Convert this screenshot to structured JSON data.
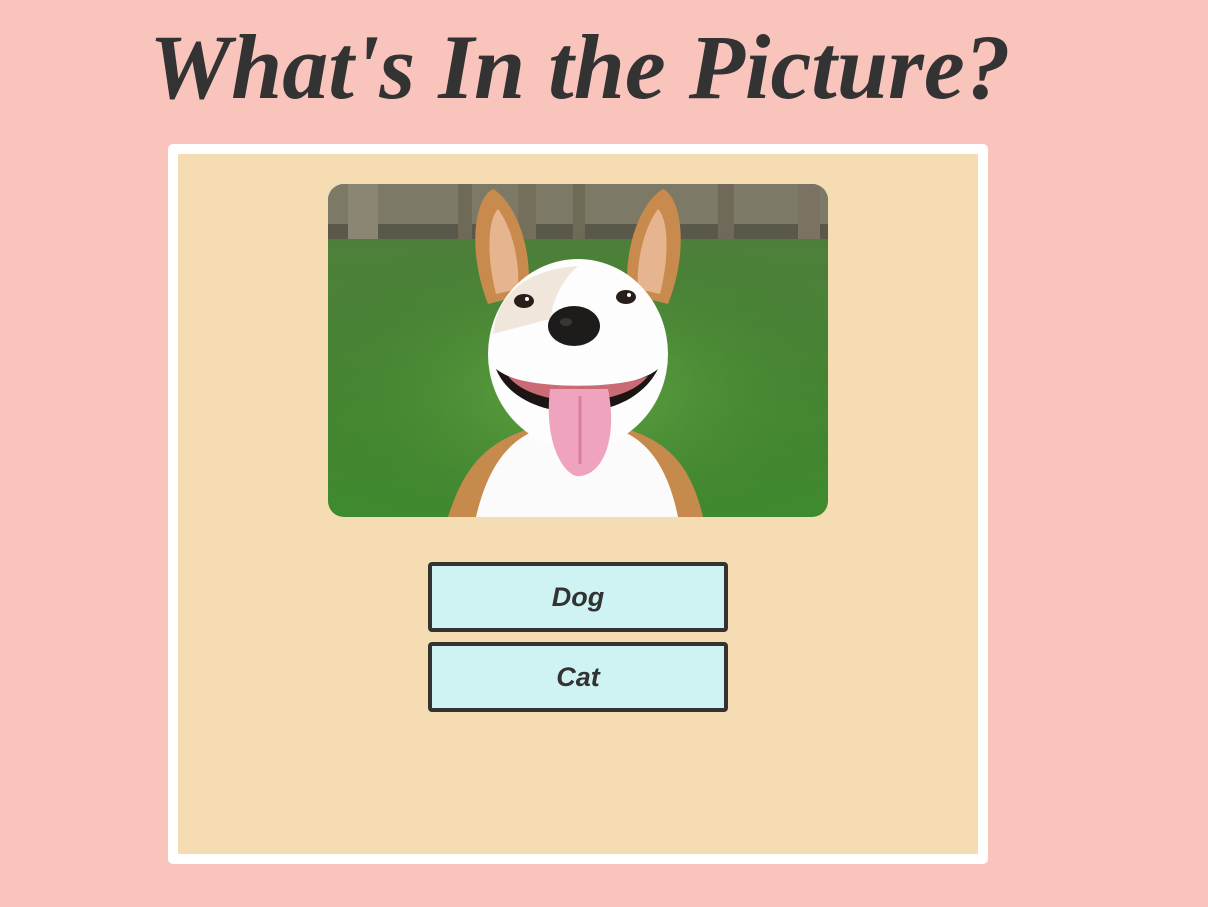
{
  "page": {
    "title": "What's In the Picture?",
    "background_color": "#f8c4bc"
  },
  "quiz": {
    "card_color": "#f5dcb2",
    "card_border_color": "#ffffff",
    "picture_icon": "dog-photo",
    "answers": [
      {
        "label": "Dog"
      },
      {
        "label": "Cat"
      }
    ],
    "button_color": "#cff3f3",
    "button_border_color": "#333333"
  }
}
